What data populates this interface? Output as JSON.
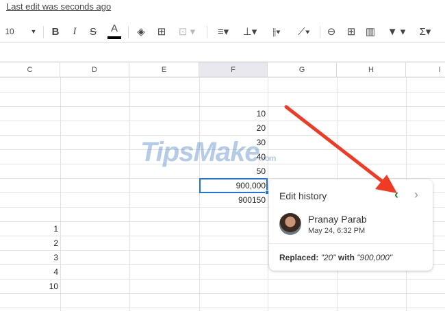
{
  "last_edit": "Last edit was seconds ago",
  "toolbar": {
    "font_size": "10",
    "bold": "B",
    "italic": "I",
    "strike": "S",
    "text_color": "A",
    "sum": "Σ"
  },
  "columns": [
    "C",
    "D",
    "E",
    "F",
    "G",
    "H",
    "I"
  ],
  "selected_column": "F",
  "cells": {
    "f": [
      "10",
      "20",
      "30",
      "40",
      "50",
      "900,000",
      "900150"
    ],
    "c": [
      "1",
      "2",
      "3",
      "4",
      "10"
    ]
  },
  "watermark": {
    "main": "TipsMake",
    "suffix": ".com"
  },
  "edit_history": {
    "title": "Edit history",
    "prev": "‹",
    "next": "›",
    "user": "Pranay Parab",
    "date": "May 24, 6:32 PM",
    "action": "Replaced:",
    "old": "\"20\"",
    "with": "with",
    "new": "\"900,000\""
  },
  "colors": {
    "accent": "#1a73e8",
    "arrow": "#f03a24",
    "prev": "#188038"
  }
}
